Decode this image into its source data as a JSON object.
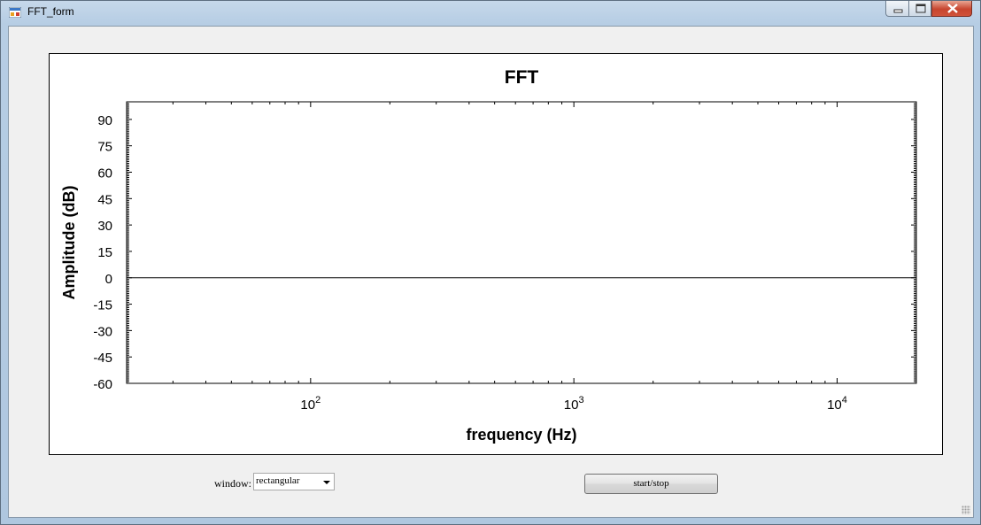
{
  "window": {
    "title": "FFT_form",
    "icon": "app-form-icon",
    "controls": [
      "minimize-icon",
      "maximize-icon",
      "close-icon"
    ]
  },
  "chart_data": {
    "type": "line",
    "title": "FFT",
    "xlabel": "frequency (Hz)",
    "ylabel": "Amplitude (dB)",
    "xscale": "log",
    "xlim": [
      20,
      20000
    ],
    "ylim": [
      -60,
      100
    ],
    "yticks": [
      "90",
      "75",
      "60",
      "45",
      "30",
      "15",
      "0",
      "-15",
      "-30",
      "-45",
      "-60"
    ],
    "xticks": [
      {
        "base": "10",
        "exp": "2"
      },
      {
        "base": "10",
        "exp": "3"
      },
      {
        "base": "10",
        "exp": "4"
      }
    ],
    "series": [
      {
        "x": [
          20,
          20000
        ],
        "y": [
          0,
          0
        ]
      }
    ],
    "grid": false,
    "line_color": "#000000"
  },
  "controls": {
    "window_label": "window:",
    "window_select_value": "rectangular",
    "start_stop_label": "start/stop"
  }
}
